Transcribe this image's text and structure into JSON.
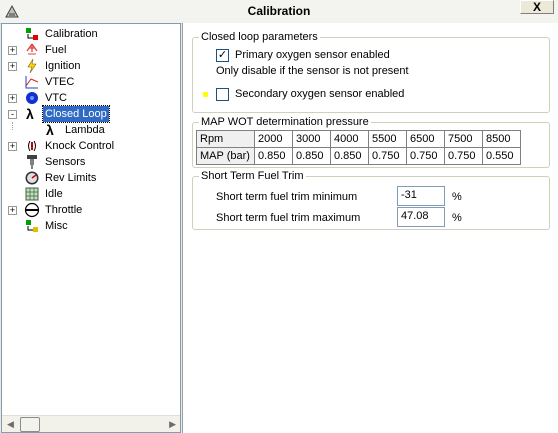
{
  "window": {
    "title": "Calibration",
    "close_label": "X"
  },
  "tree": {
    "items": [
      {
        "label": "Calibration",
        "icon": "calibration-icon",
        "expander": ""
      },
      {
        "label": "Fuel",
        "icon": "fuel-icon",
        "expander": "+"
      },
      {
        "label": "Ignition",
        "icon": "lightning-icon",
        "expander": "+"
      },
      {
        "label": "VTEC",
        "icon": "vtec-icon",
        "expander": ""
      },
      {
        "label": "VTC",
        "icon": "vtc-icon",
        "expander": "+"
      },
      {
        "label": "Closed Loop",
        "icon": "lambda-icon",
        "expander": "-",
        "selected": true
      },
      {
        "label": "Lambda",
        "icon": "lambda-icon",
        "expander": ""
      },
      {
        "label": "Knock Control",
        "icon": "knock-icon",
        "expander": "+"
      },
      {
        "label": "Sensors",
        "icon": "sensor-icon",
        "expander": ""
      },
      {
        "label": "Rev Limits",
        "icon": "rev-limit-icon",
        "expander": ""
      },
      {
        "label": "Idle",
        "icon": "idle-icon",
        "expander": ""
      },
      {
        "label": "Throttle",
        "icon": "throttle-icon",
        "expander": "+"
      },
      {
        "label": "Misc",
        "icon": "misc-icon",
        "expander": ""
      }
    ]
  },
  "closed_loop": {
    "legend": "Closed loop parameters",
    "primary_label": "Primary oxygen sensor enabled",
    "primary_checked": "✓",
    "hint": "Only disable if the sensor is not present",
    "secondary_label": "Secondary oxygen sensor enabled",
    "secondary_checked": ""
  },
  "map_wot": {
    "legend": "MAP WOT determination pressure",
    "row_labels": [
      "Rpm",
      "MAP (bar)"
    ],
    "rpm": [
      "2000",
      "3000",
      "4000",
      "5500",
      "6500",
      "7500",
      "8500"
    ],
    "map": [
      "0.850",
      "0.850",
      "0.850",
      "0.750",
      "0.750",
      "0.750",
      "0.550"
    ]
  },
  "stft": {
    "legend": "Short Term Fuel Trim",
    "min_label": "Short term fuel trim minimum",
    "min_value": "-31",
    "min_unit": "%",
    "max_label": "Short term fuel trim maximum",
    "max_value": "47.08",
    "max_unit": "%"
  },
  "colors": {
    "selection": "#316ac5",
    "indicator": "#ffff00"
  }
}
